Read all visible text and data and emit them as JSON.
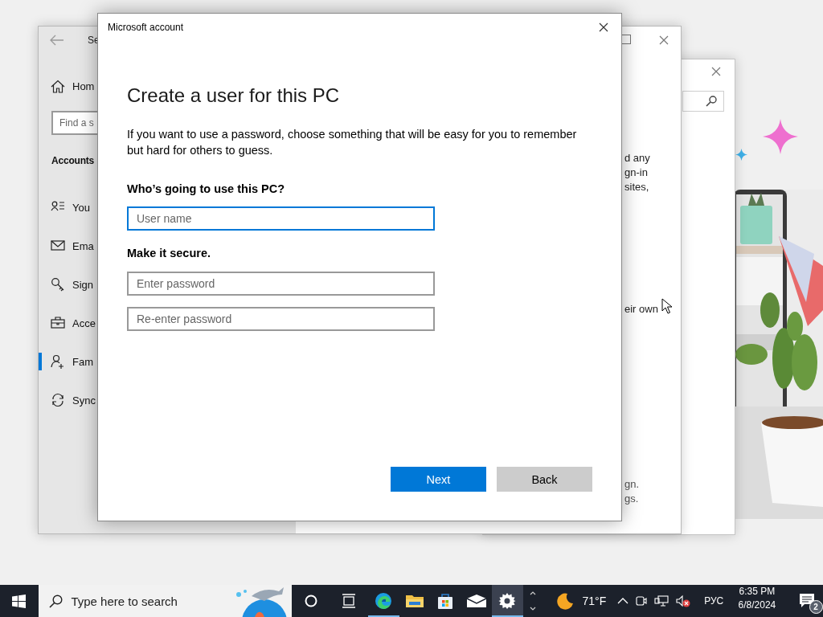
{
  "settings_window": {
    "title": "Se",
    "home_label": "Hom",
    "search": {
      "placeholder": "Find a s"
    },
    "section_title": "Accounts",
    "nav_items": [
      {
        "label": "You",
        "selected": false
      },
      {
        "label": "Ema",
        "selected": false
      },
      {
        "label": "Sign",
        "selected": false
      },
      {
        "label": "Acce",
        "selected": false
      },
      {
        "label": "Fam",
        "selected": true
      },
      {
        "label": "Sync",
        "selected": false
      }
    ],
    "content_paragraphs": [
      {
        "lines": [
          "d any",
          "gn-in",
          "sites,"
        ]
      },
      {
        "lines": [
          "eir own"
        ]
      },
      {
        "lines": [
          "gn.",
          "gs."
        ]
      }
    ]
  },
  "dialog": {
    "title": "Microsoft account",
    "heading": "Create a user for this PC",
    "description": "If you want to use a password, choose something that will be easy for you to remember but hard for others to guess.",
    "sections": [
      {
        "label": "Who’s going to use this PC?",
        "fields": [
          {
            "placeholder": "User name",
            "focused": true
          }
        ]
      },
      {
        "label": "Make it secure.",
        "fields": [
          {
            "placeholder": "Enter password",
            "focused": false
          },
          {
            "placeholder": "Re-enter password",
            "focused": false
          }
        ]
      }
    ],
    "buttons": [
      {
        "label": "Next",
        "kind": "primary"
      },
      {
        "label": "Back",
        "kind": "secondary"
      }
    ]
  },
  "taskbar": {
    "search": {
      "placeholder": "Type here to search"
    },
    "apps": [
      {
        "running": true,
        "active": false
      },
      {
        "running": false,
        "active": false
      },
      {
        "running": false,
        "active": false
      },
      {
        "running": false,
        "active": false
      },
      {
        "running": true,
        "active": true
      }
    ],
    "weather": {
      "temperature": "71°F"
    },
    "language": "РУС",
    "clock": {
      "time": "6:35 PM",
      "date": "6/8/2024"
    },
    "notifications": {
      "count": "2"
    }
  }
}
